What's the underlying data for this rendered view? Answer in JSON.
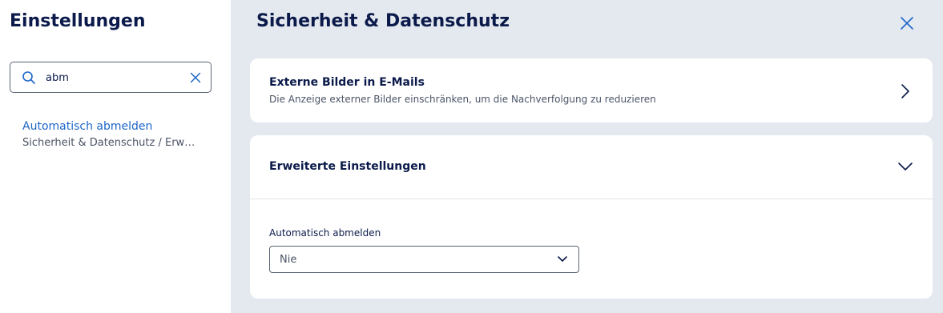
{
  "sidebar": {
    "title": "Einstellungen",
    "search": {
      "value": "abm",
      "icon": "search-icon",
      "clear_icon": "close-icon"
    },
    "results": [
      {
        "title": "Automatisch abmelden",
        "path": "Sicherheit & Datenschutz / Erweiterte Einstellungen"
      }
    ]
  },
  "main": {
    "title": "Sicherheit & Datenschutz",
    "close_icon": "close-icon",
    "cards": [
      {
        "title": "Externe Bilder in E-Mails",
        "subtitle": "Die Anzeige externer Bilder einschränken, um die Nachverfolgung zu reduzieren",
        "icon": "chevron-right-icon"
      },
      {
        "title": "Erweiterte Einstellungen",
        "icon": "chevron-down-icon",
        "field": {
          "label": "Automatisch abmelden",
          "selected": "Nie"
        }
      }
    ]
  },
  "colors": {
    "accent": "#1d66c9",
    "heading": "#0b1a4a",
    "panel_background": "#e4e9ef",
    "card_background": "#ffffff"
  }
}
